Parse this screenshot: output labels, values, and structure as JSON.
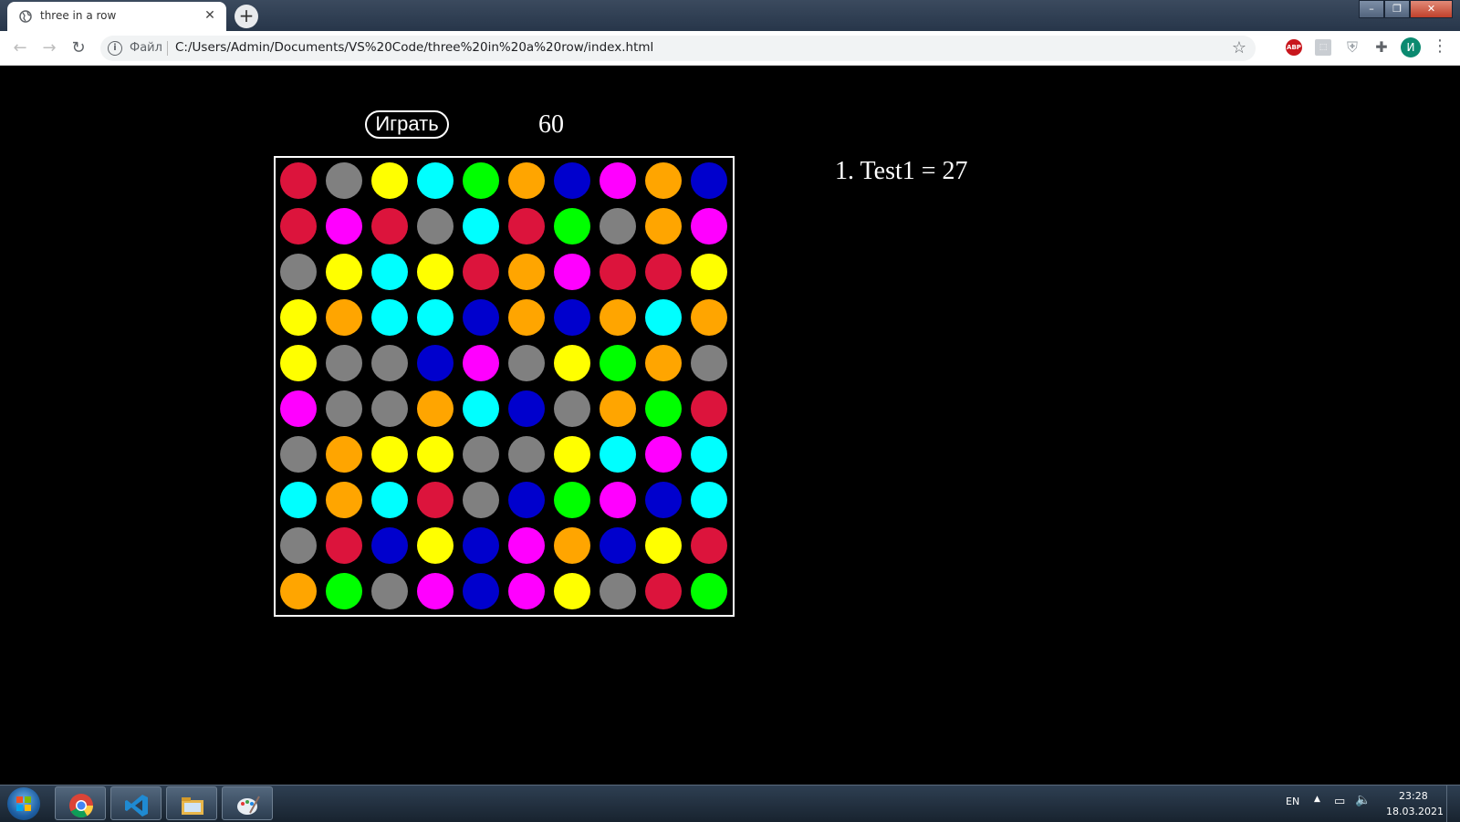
{
  "browser": {
    "tab_title": "three in a row",
    "tab_close": "✕",
    "new_tab": "+",
    "scheme_label": "Файл",
    "url": "C:/Users/Admin/Documents/VS%20Code/three%20in%20a%20row/index.html",
    "profile_initial": "И",
    "ext_abp": "ABP",
    "window_controls": {
      "min": "–",
      "max": "❐",
      "close": "✕"
    },
    "icons": [
      "back-arrow-icon",
      "forward-arrow-icon",
      "reload-icon",
      "info-icon",
      "star-icon",
      "abp-icon",
      "pdf-icon",
      "shield-icon",
      "puzzle-icon",
      "menu-icon"
    ]
  },
  "game": {
    "play_label": "Играть",
    "timer": "60",
    "palette": {
      "R": "#dc143c",
      "G": "#808080",
      "Y": "#ffff00",
      "C": "#00ffff",
      "L": "#00ff00",
      "O": "#ffa500",
      "B": "#0000cd",
      "M": "#ff00ff"
    },
    "grid": [
      "RGYCLOBMOB",
      "RMRGCRLGOM",
      "GYCYROMRRY",
      "YOCCBOBOCO",
      "YGGBMGYLOG",
      "MGGOCBGOLR",
      "GOYYGGYCMC",
      "COCRGBLMBC",
      "GRBYBMOBYR",
      "OLGMBMYGRL"
    ]
  },
  "leaderboard": [
    {
      "text": "1. Test1 = 27"
    }
  ],
  "taskbar": {
    "apps": [
      "chrome-icon",
      "vscode-icon",
      "file-explorer-icon",
      "paint-icon"
    ],
    "lang": "EN",
    "time": "23:28",
    "date": "18.03.2021"
  }
}
